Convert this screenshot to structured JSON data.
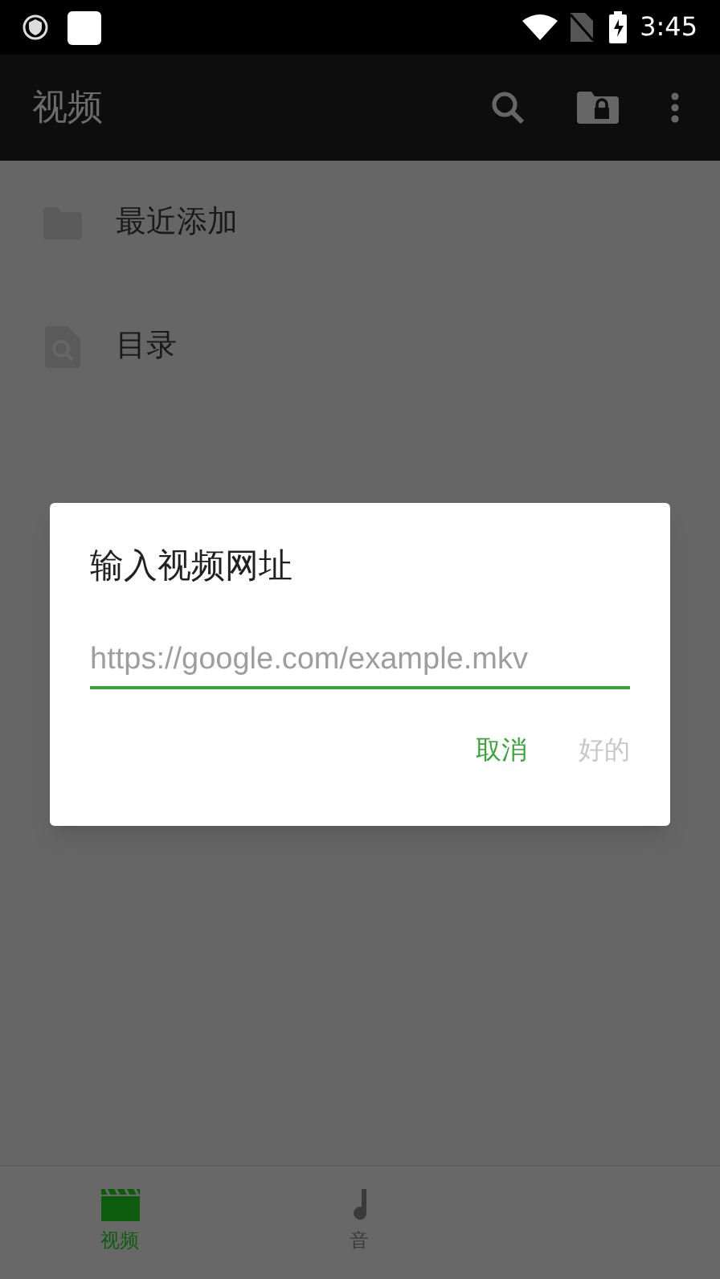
{
  "status_bar": {
    "time": "3:45"
  },
  "app_bar": {
    "title": "视频"
  },
  "list": [
    {
      "kind": "folder",
      "label": "最近添加"
    },
    {
      "kind": "browse",
      "label": "目录"
    }
  ],
  "dialog": {
    "title": "输入视频网址",
    "field": {
      "placeholder": "https://google.com/example.mkv"
    },
    "buttons": [
      {
        "label": "取消",
        "disabled": false
      },
      {
        "label": "好的",
        "disabled": true
      }
    ]
  },
  "bottom_nav": [
    {
      "kind": "video",
      "label": "视频",
      "selected": true
    },
    {
      "kind": "music",
      "label": "音",
      "selected": false
    }
  ]
}
